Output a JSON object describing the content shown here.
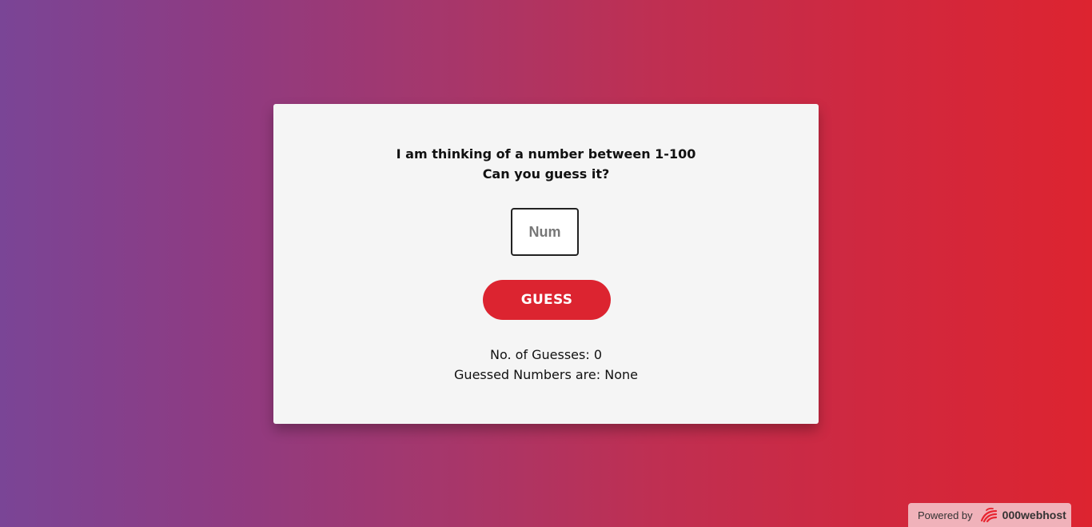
{
  "game": {
    "prompt_line1": "I am thinking of a number between 1-100",
    "prompt_line2": "Can you guess it?",
    "input_placeholder": "Num",
    "input_value": "",
    "guess_button_label": "GUESS",
    "guess_count_text": "No. of Guesses: 0",
    "guessed_numbers_text": "Guessed Numbers are: None"
  },
  "footer": {
    "powered_by_label": "Powered by",
    "brand_name": "000webhost",
    "brand_icon": "000webhost-logo-icon"
  },
  "colors": {
    "background_gradient_start": "#7a4596",
    "background_gradient_end": "#dd2430",
    "card_background": "#f5f5f5",
    "button_background": "#dc2430",
    "badge_background": "#f0b2ba"
  }
}
